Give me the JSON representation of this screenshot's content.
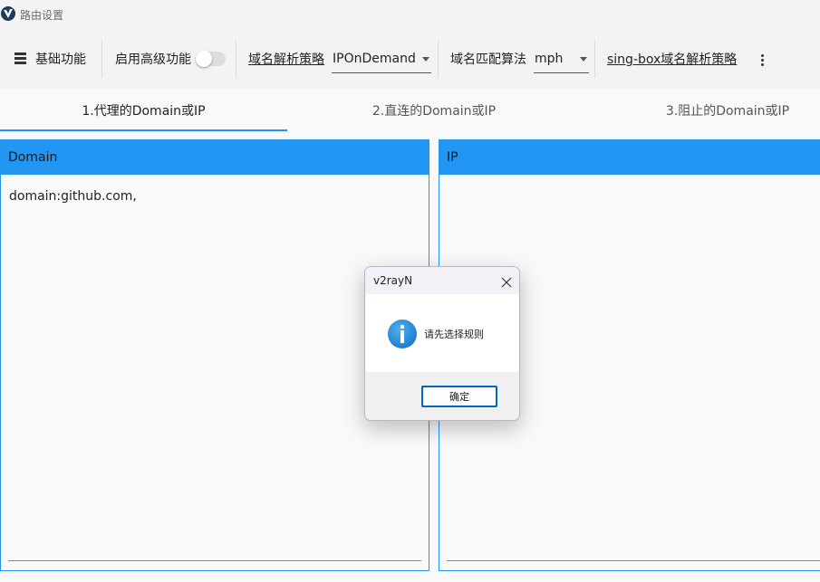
{
  "window": {
    "title": "路由设置"
  },
  "toolbar": {
    "basic_label": "基础功能",
    "advanced_label": "启用高级功能",
    "advanced_enabled": false,
    "domain_strategy_label": "域名解析策略",
    "domain_strategy_value": "IPOnDemand",
    "match_algo_label": "域名匹配算法",
    "match_algo_value": "mph",
    "singbox_label": "sing-box域名解析策略"
  },
  "tabs": [
    {
      "label": "1.代理的Domain或IP",
      "active": true
    },
    {
      "label": "2.直连的Domain或IP",
      "active": false
    },
    {
      "label": "3.阻止的Domain或IP",
      "active": false
    }
  ],
  "panels": {
    "domain": {
      "header": "Domain",
      "content": "domain:github.com,"
    },
    "ip": {
      "header": "IP",
      "content": ""
    }
  },
  "dialog": {
    "title": "v2rayN",
    "message": "请先选择规则",
    "ok_label": "确定"
  },
  "colors": {
    "accent": "#2196f3",
    "focus": "#0067c0",
    "background": "#f9f9f9"
  }
}
